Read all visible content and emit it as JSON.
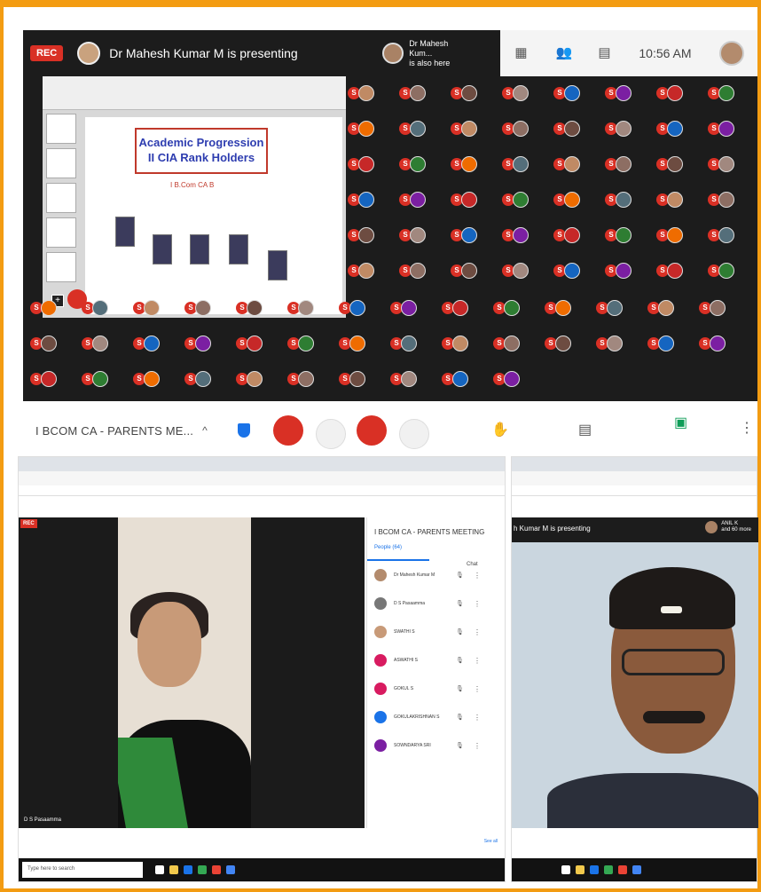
{
  "top_meeting": {
    "rec_label": "REC",
    "presenting_text": "Dr Mahesh Kumar M is presenting",
    "also_here_name": "Dr Mahesh Kum...",
    "also_here_suffix": "is also here",
    "clock": "10:56 AM",
    "header_icons": [
      "grid-icon",
      "people-icon",
      "chat-icon"
    ]
  },
  "slide": {
    "title_line1": "Academic Progression",
    "title_line2": "II CIA Rank Holders",
    "subtitle": "I B.Com CA B"
  },
  "participant_tiles": [
    "S",
    "S",
    "S",
    "S",
    "S",
    "S",
    "S",
    "S",
    "S",
    "S"
  ],
  "control_bar": {
    "meeting_name": "I BCOM CA - PARENTS ME...",
    "chevron": "^"
  },
  "lower_left": {
    "people_panel_title": "I BCOM CA - PARENTS MEETING",
    "tab_people": "People (64)",
    "tab_chat": "Chat",
    "people": [
      {
        "name": "Dr Mahesh Kumar M",
        "color": "#b38b6d"
      },
      {
        "name": "D S Pasaamma",
        "color": "#777777"
      },
      {
        "name": "SWATHI S",
        "color": "#c89a78"
      },
      {
        "name": "ASWATHI S",
        "color": "#d81b60"
      },
      {
        "name": "GOKUL S",
        "color": "#d81b60"
      },
      {
        "name": "GOKULAKRISHNAN S",
        "color": "#1a73e8"
      },
      {
        "name": "SOWNDARYA SRI",
        "color": "#7b1fa2"
      }
    ],
    "name_tag": "D S Pasaamma",
    "see_all": "See all",
    "search_placeholder": "Type here to search"
  },
  "lower_right": {
    "presenting_text": "h Kumar M is presenting",
    "also_here_line1": "ANIL K",
    "also_here_line2": "and 60 more"
  }
}
